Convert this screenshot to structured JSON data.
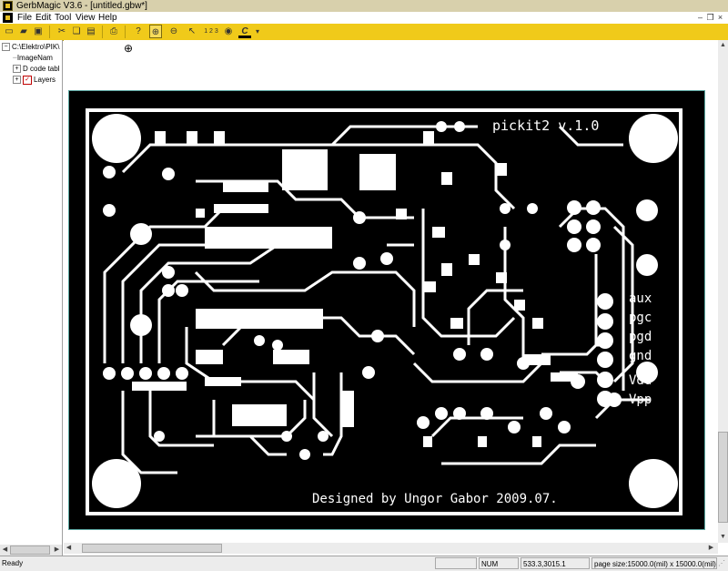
{
  "window": {
    "title": "GerbMagic V3.6 - [untitled.gbw*]"
  },
  "menu": {
    "items": [
      "File",
      "Edit",
      "Tool",
      "View",
      "Help"
    ]
  },
  "toolbar": {
    "icons": [
      "new-file-icon",
      "open-folder-icon",
      "save-icon",
      "cut-icon",
      "copy-icon",
      "paste-icon",
      "print-icon",
      "help-icon",
      "zoom-in-icon",
      "zoom-out-icon",
      "select-arrow-icon",
      "ruler-icon",
      "circle-tool-icon",
      "color-picker-icon",
      "dropdown-arrow-icon"
    ],
    "ruler_label": "1 2 3",
    "color_label": "C"
  },
  "tree": {
    "root": "C:\\Elektro\\PIK\\",
    "items": [
      {
        "label": "ImageNam"
      },
      {
        "label": "D code tabl"
      },
      {
        "label": "Layers"
      }
    ]
  },
  "board": {
    "title": "pickit2 v.1.0",
    "credit": "Designed by Ungor Gabor  2009.07.",
    "pin_labels": [
      "aux",
      "pgc",
      "pgd",
      "gnd",
      "Vdd",
      "Vpp"
    ]
  },
  "status": {
    "ready": "Ready",
    "num": "NUM",
    "coords": "533.3,3015.1",
    "page_size": "page size:15000.0(mil) x 15000.0(mil)"
  },
  "colors": {
    "toolbar": "#f0ca1a",
    "board": "#000000",
    "copper": "#ffffff",
    "outline": "#5aa6a0"
  }
}
